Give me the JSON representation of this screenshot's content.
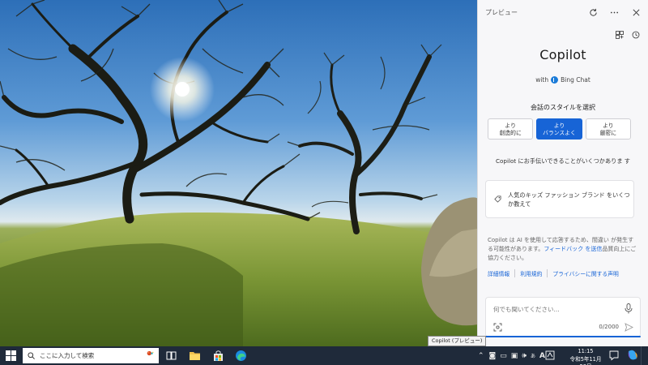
{
  "pane": {
    "header_title": "プレビュー",
    "brand_title": "Copilot",
    "brand_sub": "with",
    "brand_service": "Bing Chat",
    "style_label": "会話のスタイルを選択",
    "styles": [
      {
        "label": "より\n創造的に",
        "active": false
      },
      {
        "label": "より\nバランスよく",
        "active": true
      },
      {
        "label": "より\n厳密に",
        "active": false
      }
    ],
    "help_text": "Copilot にお手伝いできることがいくつかありま す",
    "suggestion": "人気のキッズ ファッション ブランド をいくつか教えて",
    "disclaimer_pre": "Copilot は AI を使用して応答するため、間違い が発生する可能性があります。",
    "disclaimer_link": "フィードバック を送信",
    "disclaimer_post": "品質向上にご協力ください。",
    "links": [
      "詳細情報",
      "利用規約",
      "プライバシーに関する声明"
    ],
    "input_placeholder": "何でも聞いてください...",
    "counter": "0/2000",
    "tooltip": "Copilot (プレビュー)"
  },
  "taskbar": {
    "search_placeholder": "ここに入力して検索",
    "time": "11:15",
    "date": "令和5年11月28日",
    "ime": "A"
  },
  "colors": {
    "accent": "#1764d6",
    "taskbar": "#1f2a3a",
    "pane_bg": "#f7f7f9"
  }
}
